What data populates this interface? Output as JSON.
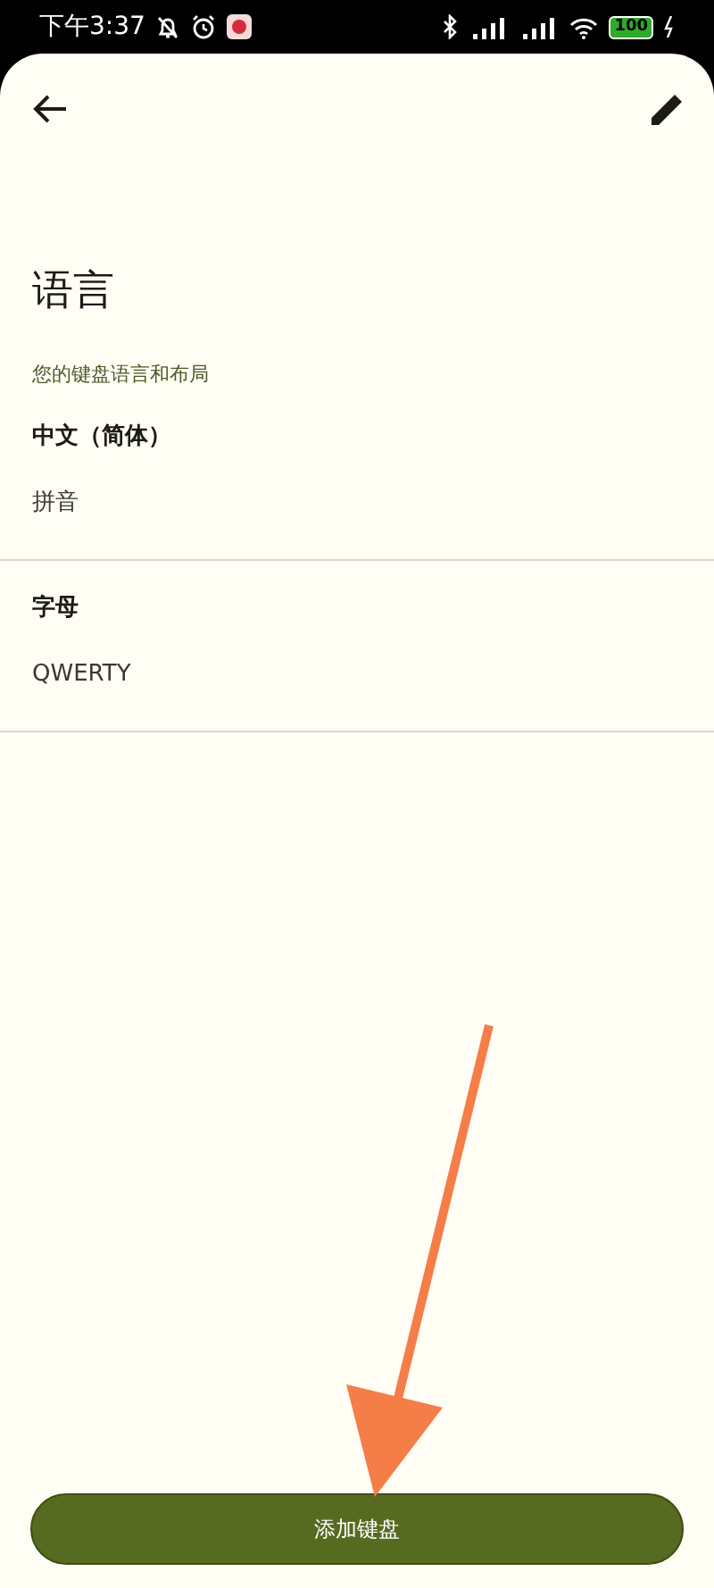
{
  "status_bar": {
    "time": "下午3:37",
    "battery": "100"
  },
  "title": "语言",
  "subtitle": "您的键盘语言和布局",
  "languages": [
    {
      "name": "中文（简体）",
      "layout": "拼音"
    },
    {
      "name": "字母",
      "layout": "QWERTY"
    }
  ],
  "add_button": "添加键盘"
}
